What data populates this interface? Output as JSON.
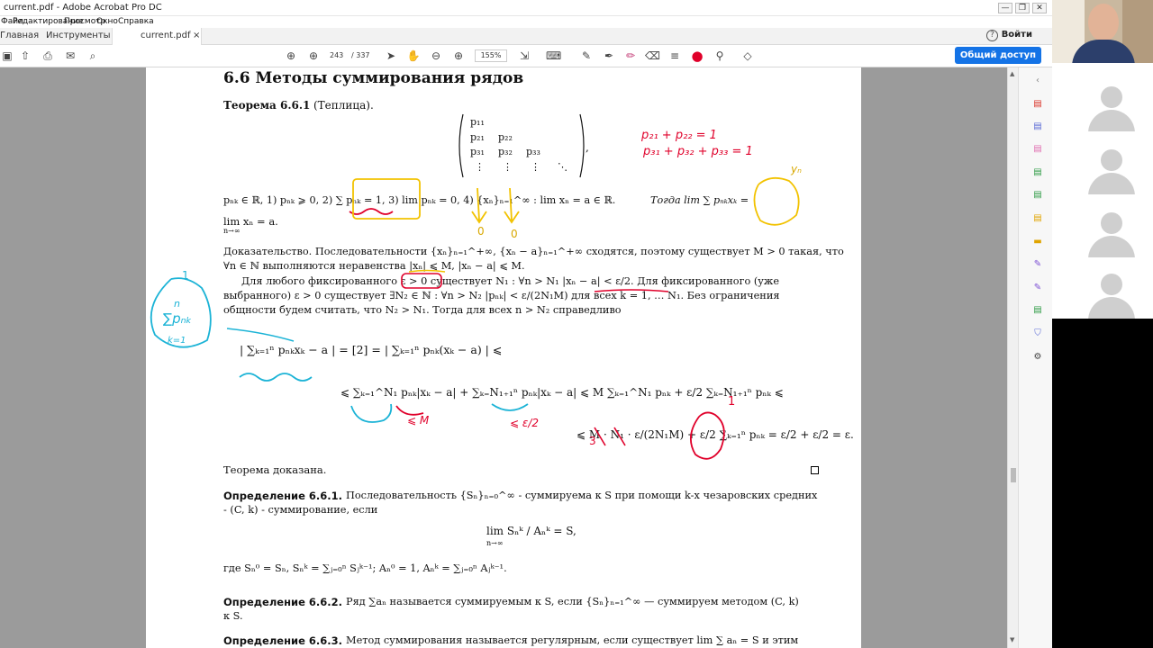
{
  "window": {
    "title": "current.pdf - Adobe Acrobat Pro DC",
    "controls": [
      "—",
      "❐",
      "✕"
    ],
    "inner_controls": [
      "—",
      "❐",
      "✕"
    ]
  },
  "menu": [
    "Файл",
    "Редактирование",
    "Просмотр",
    "Окно",
    "Справка"
  ],
  "tabs": {
    "home": "Главная",
    "tools": "Инструменты",
    "doc": "current.pdf",
    "doc_close": "×"
  },
  "account": {
    "help": "?",
    "signin": "Войти"
  },
  "toolbar": {
    "page_current": "243",
    "page_total": "/ 337",
    "zoom": "155%",
    "share_label": "Общий доступ"
  },
  "document": {
    "section_title": "6.6   Методы суммирования рядов",
    "theorem_title": "Теорема 6.6.1",
    "theorem_name": "(Теплица).",
    "matrix_rows": [
      [
        "p₁₁",
        "",
        ""
      ],
      [
        "p₂₁",
        "p₂₂",
        ""
      ],
      [
        "p₃₁",
        "p₃₂",
        "p₃₃"
      ],
      [
        "⋮",
        "⋮",
        "⋮"
      ]
    ],
    "matrix_ddots": "⋱",
    "matrix_comma": ",",
    "cond_line": "pₙₖ ∈ ℝ,  1) pₙₖ ⩾ 0,  2) ∑ pₙₖ = 1,  3) lim pₙₖ = 0,  4) {xₙ}ₙ₌₁^∞ : lim xₙ = a ∈ ℝ.",
    "cond_then": "Тогда  lim ∑ pₙₖxₖ =",
    "cond_line2": "lim xₙ = a.",
    "cond_line2_sub": "n→∞",
    "proof_p1": "Доказательство.  Последовательности {xₙ}ₙ₌₁^+∞, {xₙ − a}ₙ₌₁^+∞ сходятся, поэтому существует M > 0 такая, что",
    "proof_p2": "∀n ∈ ℕ выполняются неравенства |xₙ| ⩽ M,  |xₙ − a| ⩽ M.",
    "proof_p3": "Для любого фиксированного  ε > 0  существует N₁ : ∀n > N₁ |xₙ − a| < ε/2. Для фиксированного (уже",
    "proof_p4": "выбранного) ε > 0 существует ∃N₂ ∈ ℕ : ∀n > N₂ |pₙₖ| < ε/(2N₁M) для всех k = 1, … N₁. Без ограничения",
    "proof_p5": "общности будем считать, что N₂ > N₁. Тогда для всех n > N₂ справедливо",
    "eq1": "| ∑ₖ₌₁ⁿ pₙₖxₖ − a |  =  [2]  =  | ∑ₖ₌₁ⁿ pₙₖ(xₖ − a) |  ⩽",
    "eq2": "⩽  ∑ₖ₌₁^N₁ pₙₖ|xₖ − a|  +  ∑ₖ₌N₁₊₁ⁿ pₙₖ|xₖ − a|  ⩽  M ∑ₖ₌₁^N₁ pₙₖ  +  ε/2 ∑ₖ₌N₁₊₁ⁿ pₙₖ  ⩽",
    "eq3": "⩽  M · N₁ · ε/(2N₁M)  +  ε/2 ∑ₖ₌₁ⁿ pₙₖ  =  ε/2 + ε/2 = ε.",
    "proof_end": "Теорема доказана.",
    "def1_title": "Определение 6.6.1.",
    "def1_text": "Последовательность {Sₙ}ₙ₌₀^∞ - суммируема к S при помощи k-х чезаровских средних",
    "def1_text2": "- (C, k) - суммирование, если",
    "def1_formula": "lim Sₙᵏ / Aₙᵏ = S,",
    "def1_formula_sub": "n→∞",
    "def1_where": "где Sₙ⁰ = Sₙ,  Sₙᵏ = ∑ⱼ₌₀ⁿ Sⱼᵏ⁻¹;  Aₙ⁰ = 1,  Aₙᵏ = ∑ⱼ₌₀ⁿ Aⱼᵏ⁻¹.",
    "def2_title": "Определение 6.6.2.",
    "def2_text": "Ряд ∑aₙ называется суммируемым к S, если {Sₙ}ₙ₌₁^∞ — суммируем методом (C, k)",
    "def2_text2": "к S.",
    "def3_title": "Определение 6.6.3.",
    "def3_text": "Метод суммирования называется регулярным, если существует lim ∑ aₙ = S и этим"
  },
  "annotations": {
    "red_top1": "p₂₁ + p₂₂ = 1",
    "red_top2": "p₃₁ + p₃₂ + p₃₃ = 1",
    "yellow_yn": "yₙ",
    "yellow_o1": "0",
    "yellow_o2": "0",
    "cyan_1": "1",
    "cyan_sum": "∑pₙₖ",
    "cyan_n": "n",
    "cyan_k": "k=1",
    "red_m": "⩽ M",
    "red_eps": "⩽ ε/2",
    "red_one": "1",
    "red_strike3": "3"
  },
  "colors": {
    "accent": "#1473e6",
    "annot_red": "#e0002a",
    "annot_yellow": "#f2c200",
    "annot_cyan": "#1bb3d6",
    "page_bg": "#9b9b9b"
  }
}
